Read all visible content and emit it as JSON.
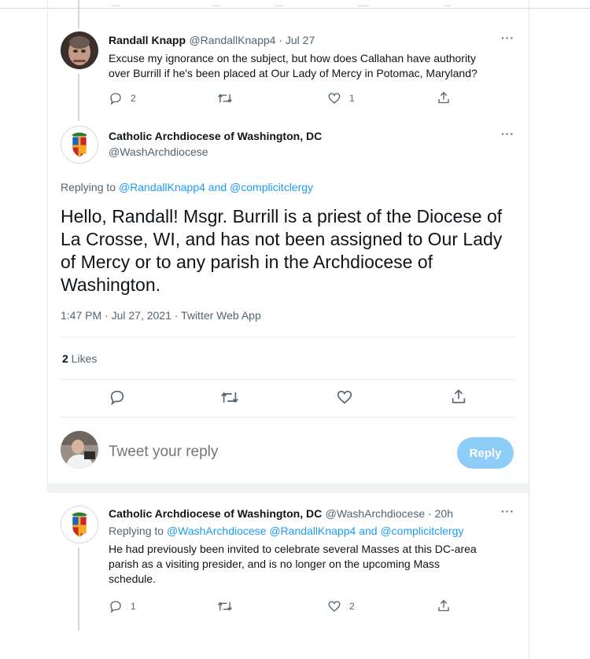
{
  "thread_top": {
    "icons": [
      "reply-icon",
      "retweet-icon",
      "like-icon",
      "share-icon"
    ]
  },
  "tweet1": {
    "author_name": "Randall Knapp",
    "handle_date": "@RandallKnapp4 · Jul 27",
    "more": "···",
    "text_lines": [
      "Excuse my ignorance on the subject, but how does Callahan have authority",
      "over Burrill if he's been placed at Our Lady of Mercy in Potomac, Maryland?"
    ],
    "reply_count": "2",
    "retweet_count": "",
    "like_count": "1"
  },
  "main_tweet": {
    "author_name": "Catholic Archdiocese of Washington, DC",
    "handle": "@WashArchdiocese",
    "more": "···",
    "replying_prefix": "Replying to ",
    "replying_to": "@RandallKnapp4 and @complicitclergy",
    "text_lines": [
      "Hello, Randall! Msgr. Burrill is a priest of the Diocese of",
      "La Crosse, WI, and has not been assigned to Our Lady",
      "of Mercy or to any parish in the Archdiocese of",
      "Washington."
    ],
    "timestamp": "1:47 PM · Jul 27, 2021 · Twitter Web App",
    "likes_count": "2",
    "likes_label": " Likes"
  },
  "composer": {
    "placeholder": "Tweet your reply",
    "button_label": "Reply",
    "button_color": "#8ecdf8"
  },
  "tweet3": {
    "author_name": "Catholic Archdiocese of Washington, DC",
    "handle_date": "@WashArchdiocese · 20h",
    "more": "···",
    "replying_prefix": "Replying to ",
    "replying_to": "@WashArchdiocese @RandallKnapp4 and @complicitclergy",
    "text_lines": [
      "He had previously been invited to celebrate several Masses at this DC-area",
      "parish as a visiting presider, and is no longer on the upcoming Mass",
      "schedule."
    ],
    "reply_count": "1",
    "retweet_count": "",
    "like_count": "2"
  },
  "colors": {
    "accent": "#1d9bf0",
    "text": "#0f1419",
    "secondary": "#536471"
  }
}
